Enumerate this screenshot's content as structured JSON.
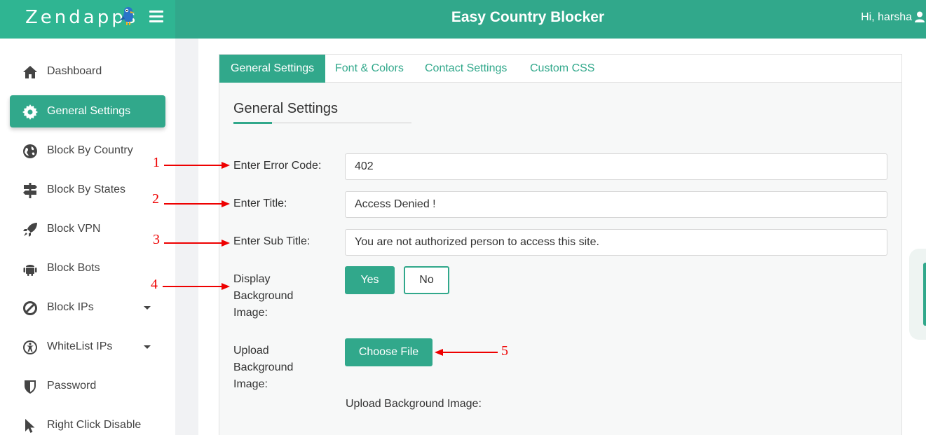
{
  "header": {
    "logo_text": "Zendapps",
    "app_title": "Easy Country Blocker",
    "greeting": "Hi, harsha"
  },
  "sidebar": {
    "items": [
      {
        "label": "Dashboard",
        "icon": "home-icon"
      },
      {
        "label": "General Settings",
        "icon": "gear-icon",
        "active": true
      },
      {
        "label": "Block By Country",
        "icon": "globe-icon"
      },
      {
        "label": "Block By States",
        "icon": "signpost-icon"
      },
      {
        "label": "Block VPN",
        "icon": "rocket-icon"
      },
      {
        "label": "Block Bots",
        "icon": "android-icon"
      },
      {
        "label": "Block IPs",
        "icon": "ban-icon",
        "has_submenu": true
      },
      {
        "label": "WhiteList IPs",
        "icon": "accessibility-icon",
        "has_submenu": true
      },
      {
        "label": "Password",
        "icon": "shield-icon"
      },
      {
        "label": "Right Click Disable",
        "icon": "cursor-icon"
      }
    ]
  },
  "tabs": [
    {
      "label": "General Settings",
      "active": true
    },
    {
      "label": "Font & Colors"
    },
    {
      "label": "Contact Settings"
    },
    {
      "label": "Custom CSS"
    }
  ],
  "form": {
    "section_title": "General Settings",
    "error_code": {
      "label": "Enter Error Code:",
      "value": "402"
    },
    "title": {
      "label": "Enter Title:",
      "value": "Access Denied !"
    },
    "sub_title": {
      "label": "Enter Sub Title:",
      "value": "You are not authorized person to access this site."
    },
    "display_bg": {
      "label_lines": [
        "Display",
        "Background",
        "Image:"
      ],
      "yes_label": "Yes",
      "no_label": "No",
      "selected": "Yes"
    },
    "upload_bg": {
      "label_lines": [
        "Upload",
        "Background",
        "Image:"
      ],
      "button_label": "Choose File",
      "caption": "Upload Background Image:"
    }
  },
  "annotations": [
    "1",
    "2",
    "3",
    "4",
    "5"
  ],
  "colors": {
    "accent": "#31a88b",
    "annotation": "#e00000"
  }
}
